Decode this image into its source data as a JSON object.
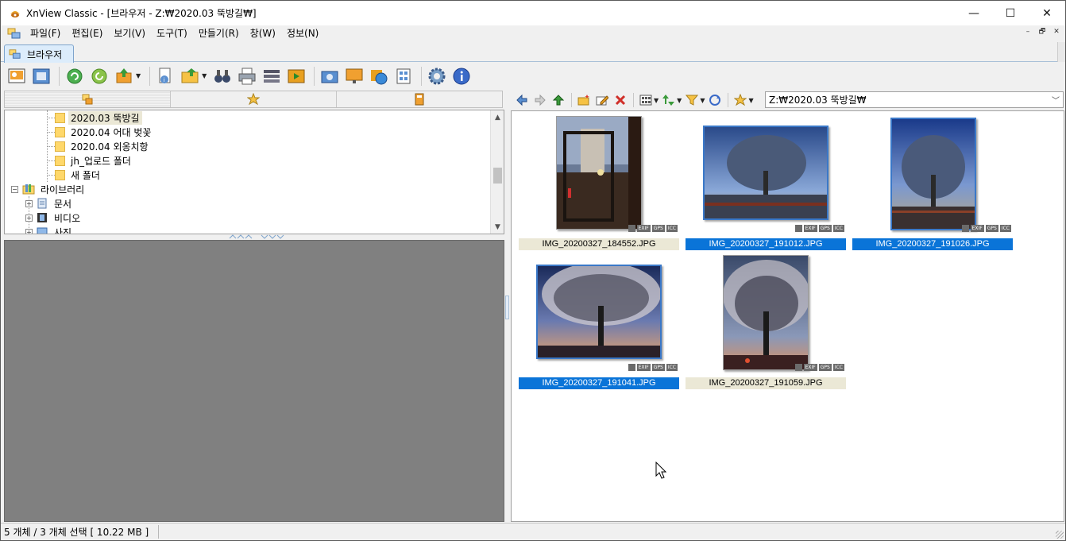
{
  "window": {
    "title": "XnView Classic - [브라우저 - Z:₩2020.03 뚝방길₩]",
    "controls": {
      "minimize": "—",
      "maximize": "☐",
      "close": "✕"
    }
  },
  "menu": {
    "items": [
      {
        "label": "파일(F)"
      },
      {
        "label": "편집(E)"
      },
      {
        "label": "보기(V)"
      },
      {
        "label": "도구(T)"
      },
      {
        "label": "만들기(R)"
      },
      {
        "label": "창(W)"
      },
      {
        "label": "정보(N)"
      }
    ],
    "mdi": {
      "minimize": "–",
      "restore": "🗗",
      "close": "✕"
    }
  },
  "tabs": [
    {
      "label": "브라우저"
    }
  ],
  "left_pane": {
    "tabs": [
      {
        "icon": "folders-icon"
      },
      {
        "icon": "favorites-star-icon"
      },
      {
        "icon": "categories-icon"
      }
    ],
    "tree": [
      {
        "label": "2020.03 뚝방길",
        "selected": true
      },
      {
        "label": "2020.04 어대 벚꽃"
      },
      {
        "label": "2020.04 외옹치항"
      },
      {
        "label": "jh_업로드 폴더"
      },
      {
        "label": "새 폴더"
      },
      {
        "label": "라이브러리",
        "expander": "−"
      },
      {
        "label": "문서",
        "expander": "+"
      },
      {
        "label": "비디오",
        "expander": "+"
      },
      {
        "label": "사진",
        "expander": "+"
      }
    ]
  },
  "path": {
    "value": "Z:₩2020.03 뚝방길₩"
  },
  "thumbnails": [
    {
      "filename": "IMG_20200327_184552.JPG",
      "selected": false,
      "badges": [
        "EXIF",
        "GPS",
        "ICC"
      ]
    },
    {
      "filename": "IMG_20200327_191012.JPG",
      "selected": true,
      "badges": [
        "EXIF",
        "GPS",
        "ICC"
      ]
    },
    {
      "filename": "IMG_20200327_191026.JPG",
      "selected": true,
      "badges": [
        "EXIF",
        "GPS",
        "ICC"
      ]
    },
    {
      "filename": "IMG_20200327_191041.JPG",
      "selected": true,
      "badges": [
        "EXIF",
        "GPS",
        "ICC"
      ]
    },
    {
      "filename": "IMG_20200327_191059.JPG",
      "selected": false,
      "badges": [
        "EXIF",
        "GPS",
        "ICC"
      ]
    }
  ],
  "status": {
    "text": "5 개체 / 3 개체 선택   [ 10.22 MB ]"
  },
  "colors": {
    "selection": "#0a74d8",
    "unselected_label": "#ebe8d6",
    "preview_bg": "#808080"
  }
}
